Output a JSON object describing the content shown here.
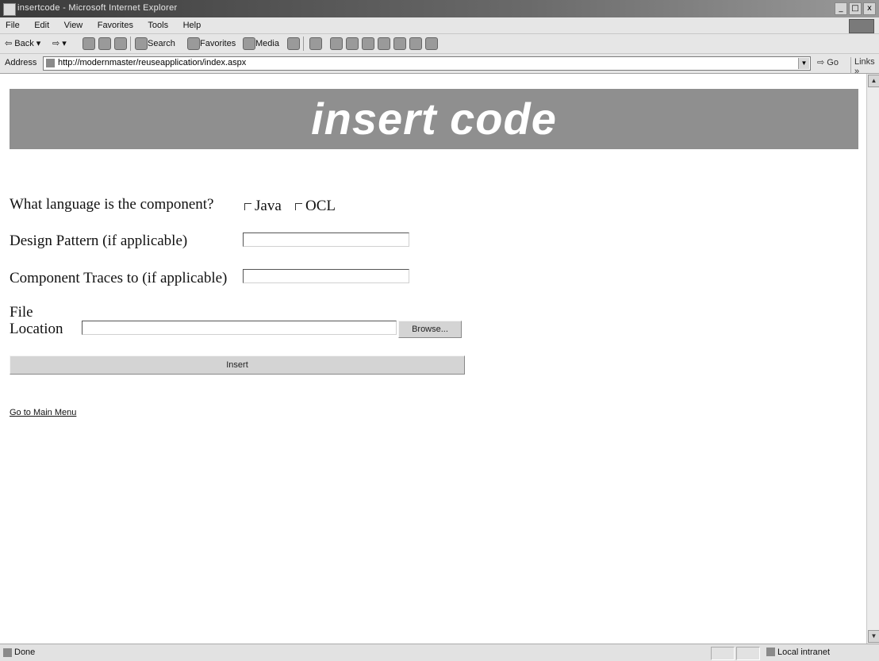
{
  "window": {
    "title": "insertcode - Microsoft Internet Explorer",
    "controls": [
      "_",
      "□",
      "x"
    ]
  },
  "menu": [
    "File",
    "Edit",
    "View",
    "Favorites",
    "Tools",
    "Help"
  ],
  "toolbar": {
    "back": "Back",
    "search": "Search",
    "favorites": "Favorites",
    "media": "Media"
  },
  "address": {
    "label": "Address",
    "url": "http://modernmaster/reuseapplication/index.aspx",
    "go": "Go",
    "links": "Links »"
  },
  "page": {
    "banner": "insert code",
    "language_question": "What language is the component?",
    "language_options": [
      "Java",
      "OCL"
    ],
    "design_pattern_label": "Design Pattern (if applicable)",
    "design_pattern_value": "",
    "traces_label": "Component Traces to (if applicable)",
    "traces_value": "",
    "file_label_line1": "File",
    "file_label_line2": "Location",
    "file_value": "",
    "browse_label": "Browse...",
    "insert_label": "Insert",
    "main_menu_link": "Go to Main Menu"
  },
  "status": {
    "text": "Done",
    "zone": "Local intranet"
  },
  "colors": {
    "banner_bg": "#8f8f8f",
    "banner_text": "#ffffff",
    "titlebar": "#4a4a4a"
  }
}
